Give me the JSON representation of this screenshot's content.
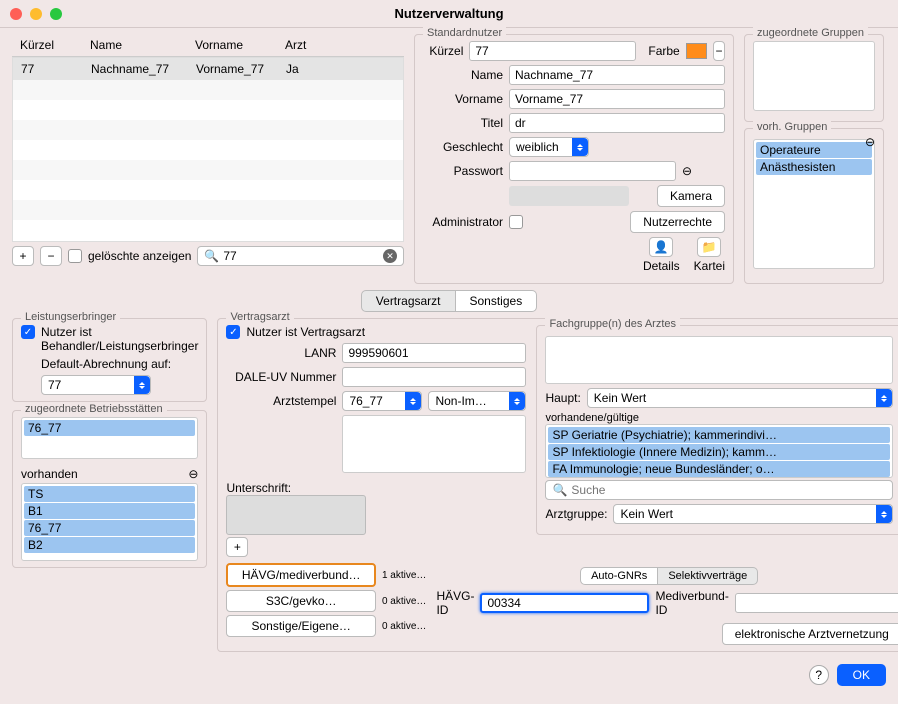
{
  "window": {
    "title": "Nutzerverwaltung"
  },
  "users_table": {
    "cols": [
      "Kürzel",
      "Name",
      "Vorname",
      "Arzt"
    ],
    "rows": [
      {
        "kuerzel": "77",
        "name": "Nachname_77",
        "vorname": "Vorname_77",
        "arzt": "Ja"
      }
    ]
  },
  "users_footer": {
    "show_deleted": "gelöschte anzeigen",
    "search_value": "77"
  },
  "std": {
    "title": "Standardnutzer",
    "labels": {
      "kuerzel": "Kürzel",
      "farbe": "Farbe",
      "name": "Name",
      "vorname": "Vorname",
      "titel": "Titel",
      "geschlecht": "Geschlecht",
      "passwort": "Passwort",
      "admin": "Administrator"
    },
    "values": {
      "kuerzel": "77",
      "name": "Nachname_77",
      "vorname": "Vorname_77",
      "titel": "dr",
      "geschlecht": "weiblich"
    },
    "buttons": {
      "kamera": "Kamera",
      "nutzerrechte": "Nutzerrechte",
      "details": "Details",
      "kartei": "Kartei"
    }
  },
  "groups": {
    "assigned_title": "zugeordnete Gruppen",
    "available_title": "vorh. Gruppen",
    "available": [
      "Operateure",
      "Anästhesisten"
    ]
  },
  "tabs": {
    "t1": "Vertragsarzt",
    "t2": "Sonstiges"
  },
  "leist": {
    "title": "Leistungserbringer",
    "chk": "Nutzer ist Behandler/Leistungserbringer",
    "default_label": "Default-Abrechnung auf:",
    "default_value": "77"
  },
  "betrieb": {
    "title": "zugeordnete Betriebsstätten",
    "assigned": [
      "76_77"
    ],
    "avail_title": "vorhanden",
    "available": [
      "TS",
      "B1",
      "76_77",
      "B2"
    ]
  },
  "vertrag": {
    "title": "Vertragsarzt",
    "chk": "Nutzer ist Vertragsarzt",
    "labels": {
      "lanr": "LANR",
      "dale": "DALE-UV Nummer",
      "stempel": "Arztstempel",
      "unterschrift": "Unterschrift:"
    },
    "values": {
      "lanr": "999590601",
      "stempel1": "76_77",
      "stempel2": "Non-Im…"
    }
  },
  "fach": {
    "title": "Fachgruppe(n) des Arztes",
    "haupt_label": "Haupt:",
    "haupt_value": "Kein Wert",
    "vorhanden_label": "vorhandene/gültige",
    "list": [
      "SP Geriatrie (Psychiatrie); kammerindivi…",
      "SP Infektiologie (Innere Medizin); kamm…",
      "FA Immunologie; neue Bundesländer; o…"
    ],
    "search_ph": "Suche",
    "arztgruppe_label": "Arztgruppe:",
    "arztgruppe_value": "Kein Wert"
  },
  "sub_tabs": {
    "t1": "Auto-GNRs",
    "t2": "Selektivverträge"
  },
  "selektiv": {
    "rows": [
      {
        "label": "HÄVG/mediverbund…",
        "count": "1 aktive…"
      },
      {
        "label": "S3C/gevko…",
        "count": "0 aktive…"
      },
      {
        "label": "Sonstige/Eigene…",
        "count": "0 aktive…"
      }
    ],
    "havg_label": "HÄVG-ID",
    "havg_value": "00334",
    "medi_label": "Mediverbund-ID",
    "elek": "elektronische Arztvernetzung"
  },
  "footer": {
    "ok": "OK"
  }
}
